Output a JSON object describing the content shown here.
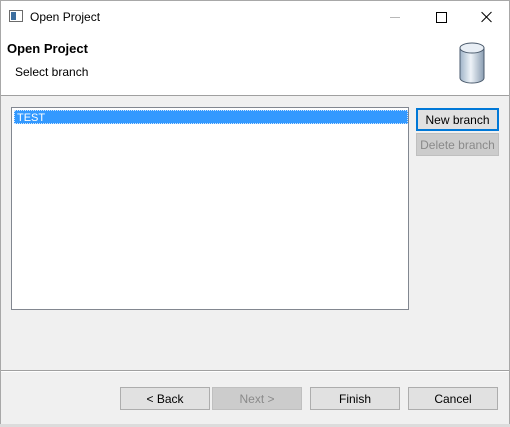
{
  "window": {
    "title": "Open Project"
  },
  "title_controls": {
    "minimize": "minimize-icon",
    "maximize": "maximize-icon",
    "close": "close-icon"
  },
  "banner": {
    "title": "Open Project",
    "subtitle": "Select branch",
    "icon": "database-icon"
  },
  "branches": {
    "items": [
      "TEST"
    ],
    "selected": "TEST"
  },
  "side_buttons": {
    "new_branch": "New branch",
    "delete_branch": "Delete branch"
  },
  "footer": {
    "back": "< Back",
    "next": "Next >",
    "finish": "Finish",
    "cancel": "Cancel"
  },
  "colors": {
    "selection": "#3399ff",
    "default_border": "#0078d7",
    "banner_bg": "#ffffff"
  }
}
